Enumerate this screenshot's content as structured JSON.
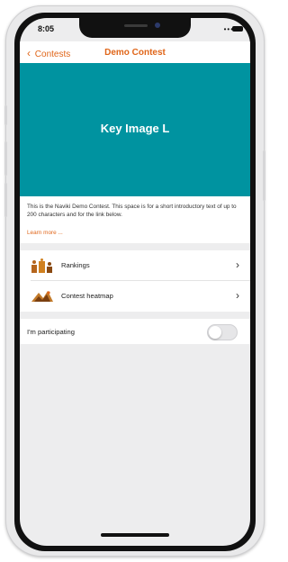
{
  "status_bar": {
    "time": "8:05"
  },
  "nav": {
    "back_label": "Contests",
    "title": "Demo Contest"
  },
  "hero": {
    "text": "Key Image L",
    "color": "#0093a0"
  },
  "intro": {
    "text": "This is the Naviki Demo Contest. This space is for a short introductory text of up to 200 characters and for the link below.",
    "link": "Learn more ..."
  },
  "menu": {
    "items": [
      {
        "label": "Rankings",
        "icon": "rankings-icon"
      },
      {
        "label": "Contest heatmap",
        "icon": "heatmap-icon"
      }
    ]
  },
  "participating": {
    "label": "I'm participating",
    "on": false
  },
  "accent": "#e0661a"
}
